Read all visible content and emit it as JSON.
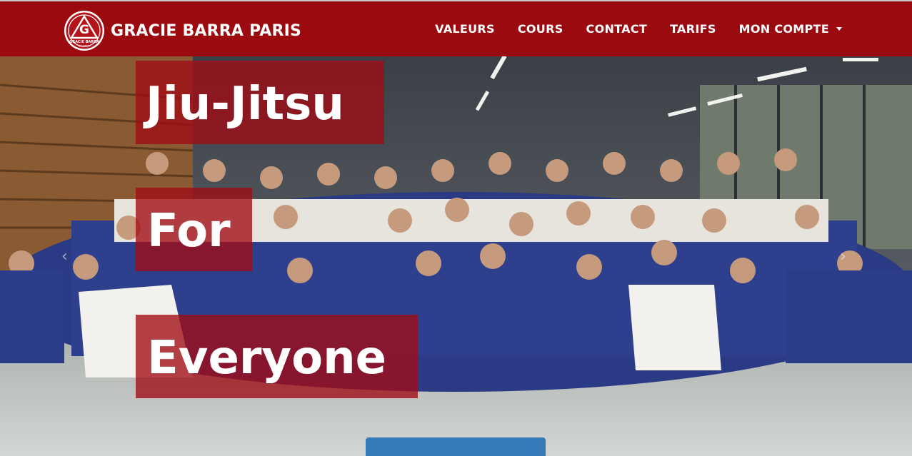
{
  "header": {
    "brand_name": "GRACIE BARRA PARIS",
    "logo_text_top": "GRACIE BARRA",
    "logo_text_bottom": "JIU-JITSU",
    "logo_letter": "G"
  },
  "nav": {
    "items": [
      {
        "label": "VALEURS"
      },
      {
        "label": "COURS"
      },
      {
        "label": "CONTACT"
      },
      {
        "label": "TARIFS"
      },
      {
        "label": "MON COMPTE",
        "dropdown": true
      }
    ]
  },
  "hero": {
    "line1": "Jiu-Jitsu",
    "line2": "For",
    "line3": "Everyone",
    "cta_label": "",
    "arrow_left": "‹",
    "arrow_right": "›"
  },
  "colors": {
    "brand_red": "#9b0a0f",
    "headline_overlay": "#a00c14",
    "cta_blue": "#337ab7"
  },
  "icons": [
    "gracie-barra-logo-icon",
    "chevron-down-icon",
    "carousel-prev-icon",
    "carousel-next-icon"
  ]
}
